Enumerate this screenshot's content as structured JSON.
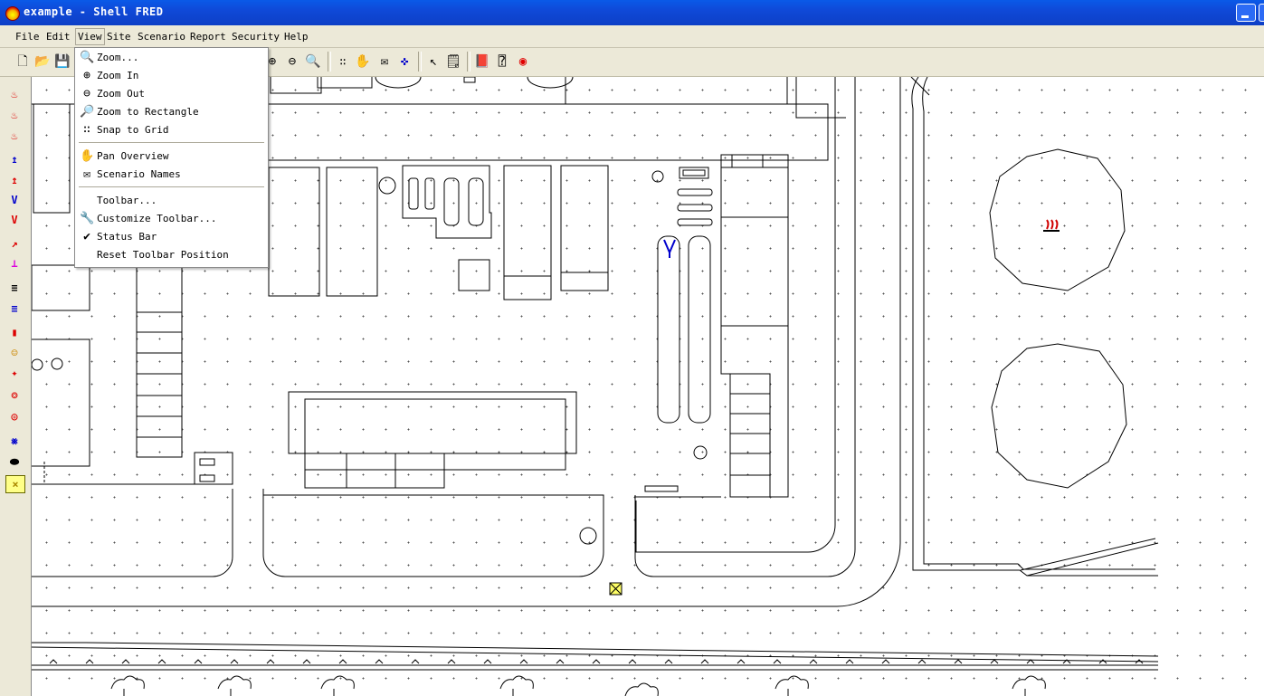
{
  "window": {
    "title": "example - Shell FRED"
  },
  "menubar": {
    "items": [
      {
        "label": "File"
      },
      {
        "label": "Edit"
      },
      {
        "label": "View"
      },
      {
        "label": "Site"
      },
      {
        "label": "Scenario"
      },
      {
        "label": "Report"
      },
      {
        "label": "Security"
      },
      {
        "label": "Help"
      }
    ]
  },
  "view_menu": {
    "items": [
      {
        "label": "Zoom...",
        "icon": "zoom-icon"
      },
      {
        "label": "Zoom In",
        "icon": "zoom-in-icon"
      },
      {
        "label": "Zoom Out",
        "icon": "zoom-out-icon"
      },
      {
        "label": "Zoom to Rectangle",
        "icon": "zoom-rectangle-icon"
      },
      {
        "label": "Snap to Grid",
        "icon": "grid-icon"
      },
      {
        "label": "Pan Overview",
        "icon": "hand-icon"
      },
      {
        "label": "Scenario Names",
        "icon": "label-icon"
      },
      {
        "label": "Toolbar...",
        "icon": ""
      },
      {
        "label": "Customize Toolbar...",
        "icon": "wrench-icon"
      },
      {
        "label": "Status Bar",
        "icon": "check-icon",
        "checked": true
      },
      {
        "label": "Reset Toolbar Position",
        "icon": ""
      }
    ]
  },
  "colors": {
    "titlebar": "#0d47d4",
    "chrome": "#ece9d8",
    "accent_red": "#d00000",
    "accent_blue": "#0000cc"
  }
}
